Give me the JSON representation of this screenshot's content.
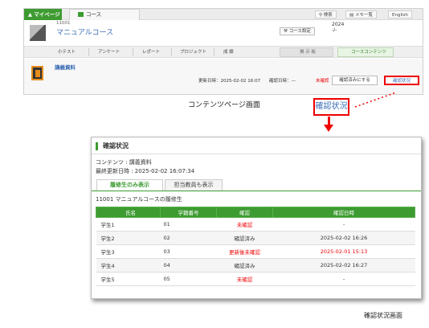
{
  "top": {
    "mypage_tab": "マイページ",
    "course_tab": "コース",
    "toolbar": {
      "search": "検索",
      "memo": "メモ一覧",
      "lang": "English"
    },
    "course": {
      "id": "11001",
      "name": "マニュアルコース",
      "settings_button": "コース設定",
      "year": "2024",
      "term": "-/-"
    },
    "nav": [
      "小テスト",
      "アンケート",
      "レポート",
      "プロジェクト",
      "成 績"
    ],
    "board": "掲 示 板",
    "contents": "コースコンテンツ",
    "doc_title": "講義資料",
    "updated_label": "更新日時：",
    "updated_value": "2025-02-02 16:07",
    "confirm_date_label": "確認日時：",
    "confirm_date_value": "—",
    "status": "未確認",
    "confirm_button": "確認済みにする",
    "status_button": "確認状況"
  },
  "caption_top": "コンテンツページ画面",
  "zoom_label": "確認状況",
  "panel": {
    "title": "確認状況",
    "content_line": "コンテンツ : 講義資料",
    "updated_line": "最終更新日時 : 2025-02-02 16:07:34",
    "tab_active": "履修生のみ表示",
    "tab_inactive": "担当教員も表示",
    "table_title": "11001 マニュアルコースの履修生",
    "headers": [
      "氏名",
      "学籍番号",
      "確認",
      "確認日時"
    ],
    "rows": [
      {
        "name": "学生1",
        "id": "01",
        "status": "未確認",
        "date": "-"
      },
      {
        "name": "学生2",
        "id": "02",
        "status": "確認済み",
        "date": "2025-02-02 16:26"
      },
      {
        "name": "学生3",
        "id": "03",
        "status": "更新後未確認",
        "date": "2025-02-01 15:13"
      },
      {
        "name": "学生4",
        "id": "04",
        "status": "確認済み",
        "date": "2025-02-02 16:27"
      },
      {
        "name": "学生5",
        "id": "05",
        "status": "未確認",
        "date": "-"
      }
    ]
  },
  "caption_bottom": "確認状況画面",
  "colors": {
    "green": "#3d9b31",
    "red": "#e00000",
    "link": "#3b6db5"
  }
}
